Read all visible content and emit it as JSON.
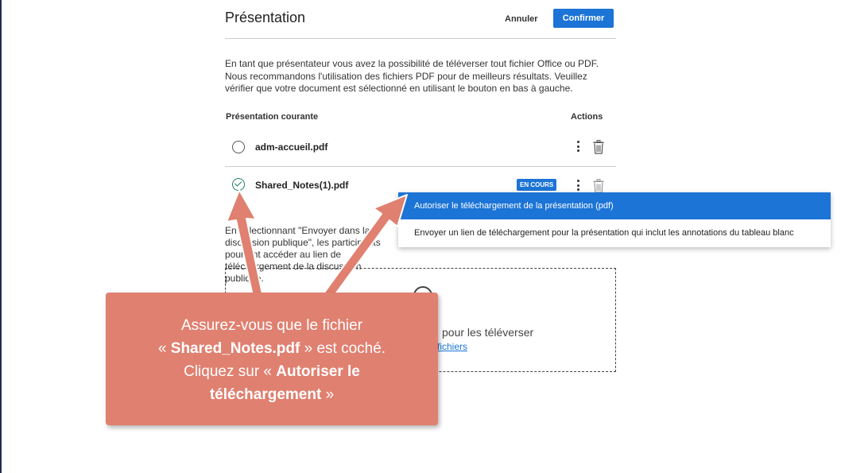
{
  "header": {
    "title": "Présentation",
    "cancel_label": "Annuler",
    "confirm_label": "Confirmer"
  },
  "intro_text": "En tant que présentateur vous avez la possibilité de téléverser tout fichier Office ou PDF. Nous recommandons l'utilisation des fichiers PDF pour de meilleurs résultats. Veuillez vérifier que votre document est sélectionné en utilisant le bouton en bas à gauche.",
  "table": {
    "col_current": "Présentation courante",
    "col_actions": "Actions",
    "rows": [
      {
        "filename": "adm-accueil.pdf",
        "selected": false,
        "badge": ""
      },
      {
        "filename": "Shared_Notes(1).pdf",
        "selected": true,
        "badge": "EN COURS"
      }
    ]
  },
  "dropdown": {
    "items": [
      {
        "label": "Autoriser le téléchargement de la présentation (pdf)",
        "highlighted": true
      },
      {
        "label": "Envoyer un lien de téléchargement pour la présentation qui inclut les annotations du tableau blanc",
        "highlighted": false
      }
    ]
  },
  "note_text": "En sélectionnant \"Envoyer dans la discussion publique\", les participants pourront accéder au lien de téléchargement de la discussion publique.",
  "dropzone": {
    "text": "pour les téléverser",
    "link": "fichiers"
  },
  "callout": {
    "line1": "Assurez-vous que le fichier",
    "line2_pre": "« ",
    "line2_bold": "Shared_Notes.pdf",
    "line2_post": " » est coché.",
    "line3_pre": "Cliquez sur « ",
    "line3_bold": "Autoriser le",
    "line4_bold": "téléchargement",
    "line4_post": " »"
  },
  "colors": {
    "accent": "#1c74d6",
    "callout": "#e08070",
    "selected_check": "#1e7f5a"
  }
}
